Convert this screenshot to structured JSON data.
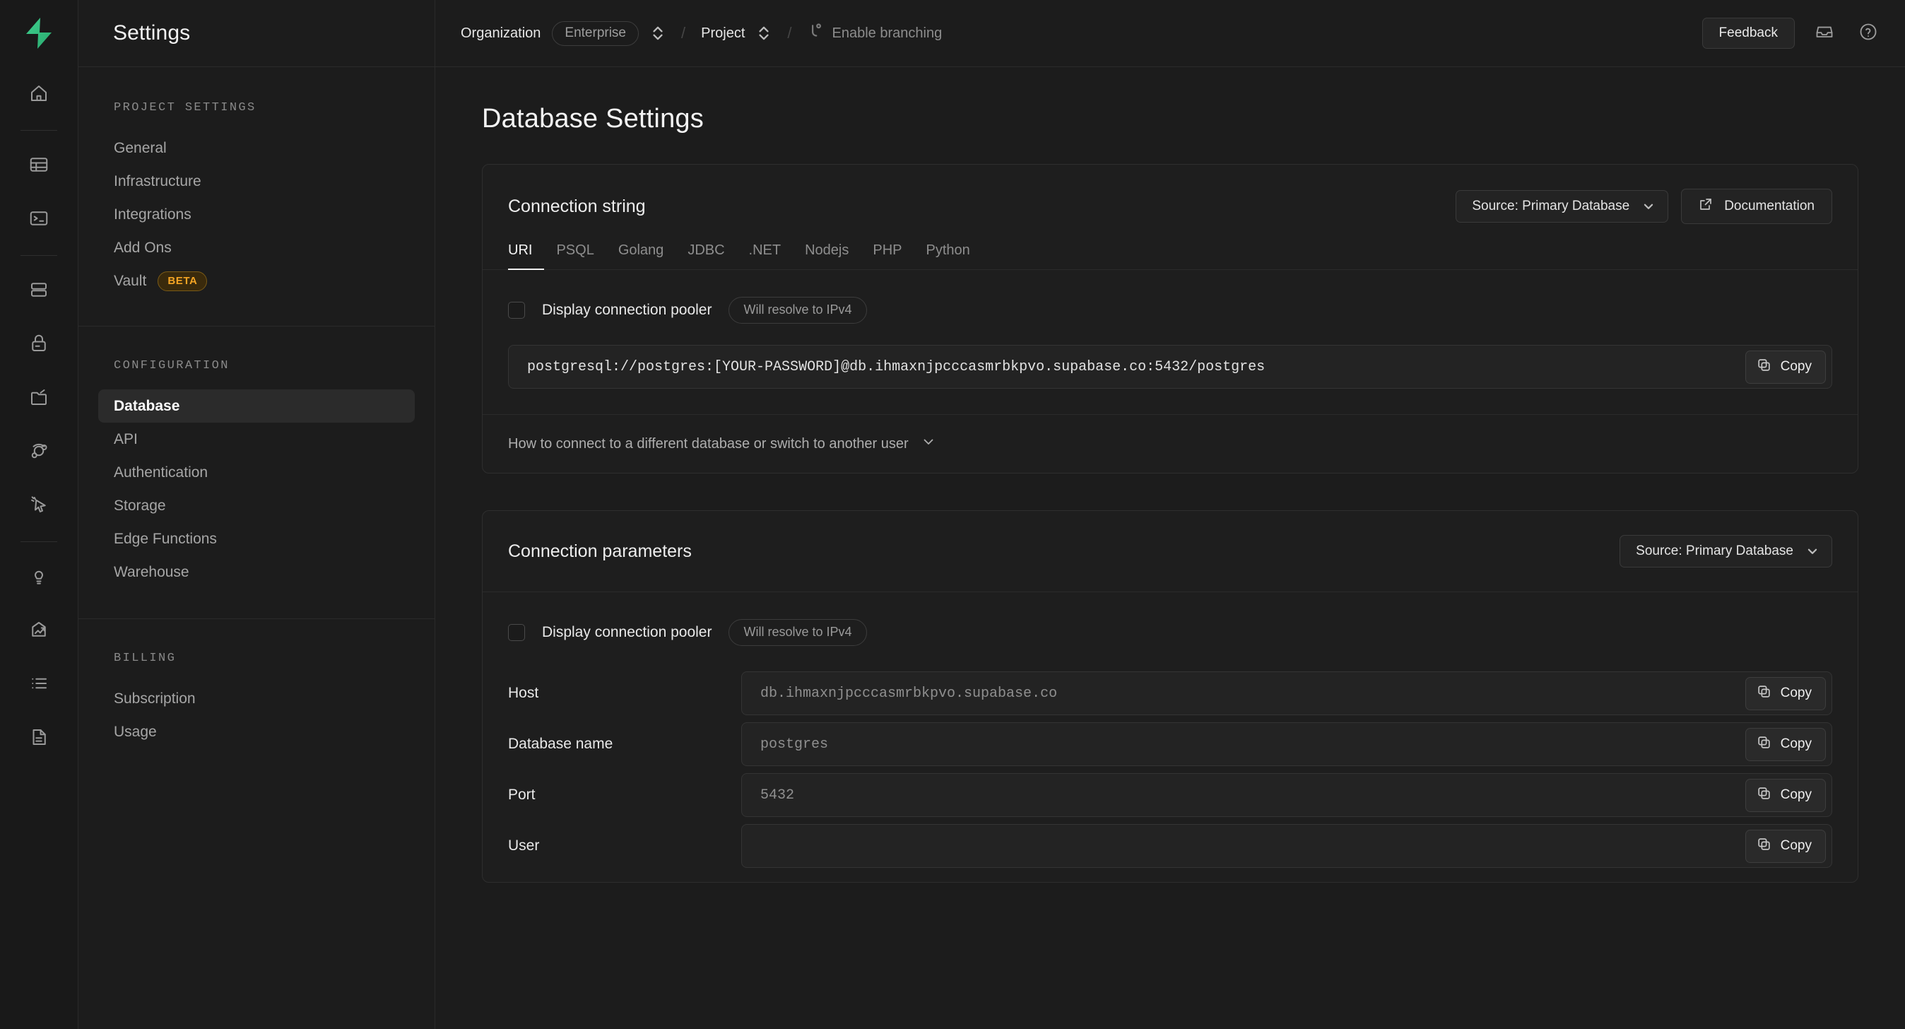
{
  "rail": {
    "logo": "supabase-logo",
    "items": [
      {
        "name": "home-icon"
      },
      {
        "name": "table-editor-icon"
      },
      {
        "name": "sql-editor-icon"
      },
      {
        "name": "database-icon"
      },
      {
        "name": "authentication-icon"
      },
      {
        "name": "storage-icon"
      },
      {
        "name": "realtime-icon"
      },
      {
        "name": "advisors-icon"
      },
      {
        "name": "integrations-icon"
      },
      {
        "name": "reports-icon"
      },
      {
        "name": "logs-icon"
      },
      {
        "name": "api-docs-icon"
      }
    ]
  },
  "sidebar": {
    "title": "Settings",
    "groups": [
      {
        "label": "PROJECT SETTINGS",
        "items": [
          {
            "label": "General",
            "active": false
          },
          {
            "label": "Infrastructure",
            "active": false
          },
          {
            "label": "Integrations",
            "active": false
          },
          {
            "label": "Add Ons",
            "active": false
          },
          {
            "label": "Vault",
            "active": false,
            "badge": "BETA"
          }
        ]
      },
      {
        "label": "CONFIGURATION",
        "items": [
          {
            "label": "Database",
            "active": true
          },
          {
            "label": "API",
            "active": false
          },
          {
            "label": "Authentication",
            "active": false
          },
          {
            "label": "Storage",
            "active": false
          },
          {
            "label": "Edge Functions",
            "active": false
          },
          {
            "label": "Warehouse",
            "active": false
          }
        ]
      },
      {
        "label": "BILLING",
        "items": [
          {
            "label": "Subscription",
            "active": false
          },
          {
            "label": "Usage",
            "active": false
          }
        ]
      }
    ]
  },
  "topbar": {
    "organization_label": "Organization",
    "organization_value": "Enterprise",
    "project_label": "Project",
    "branching_label": "Enable branching",
    "separator": "/",
    "feedback_label": "Feedback",
    "inbox_icon": "inbox-icon",
    "help_icon": "help-circle-icon"
  },
  "page": {
    "title": "Database Settings"
  },
  "connection_string": {
    "title": "Connection string",
    "source_label": "Source: Primary Database",
    "documentation_label": "Documentation",
    "tabs": [
      {
        "label": "URI",
        "active": true
      },
      {
        "label": "PSQL",
        "active": false
      },
      {
        "label": "Golang",
        "active": false
      },
      {
        "label": "JDBC",
        "active": false
      },
      {
        "label": ".NET",
        "active": false
      },
      {
        "label": "Nodejs",
        "active": false
      },
      {
        "label": "PHP",
        "active": false
      },
      {
        "label": "Python",
        "active": false
      }
    ],
    "pooler_label": "Display connection pooler",
    "pooler_checked": false,
    "ipv4_pill": "Will resolve to IPv4",
    "value": "postgresql://postgres:[YOUR-PASSWORD]@db.ihmaxnjpcccasmrbkpvo.supabase.co:5432/postgres",
    "copy_label": "Copy",
    "footer_label": "How to connect to a different database or switch to another user"
  },
  "connection_parameters": {
    "title": "Connection parameters",
    "source_label": "Source: Primary Database",
    "pooler_label": "Display connection pooler",
    "pooler_checked": false,
    "ipv4_pill": "Will resolve to IPv4",
    "copy_label": "Copy",
    "rows": [
      {
        "label": "Host",
        "value": "db.ihmaxnjpcccasmrbkpvo.supabase.co"
      },
      {
        "label": "Database name",
        "value": "postgres"
      },
      {
        "label": "Port",
        "value": "5432"
      },
      {
        "label": "User",
        "value": ""
      }
    ]
  },
  "colors": {
    "brand": "#3ecf8e",
    "beta": "#f5a524",
    "background": "#1c1c1c",
    "card": "#1e1e1e"
  }
}
